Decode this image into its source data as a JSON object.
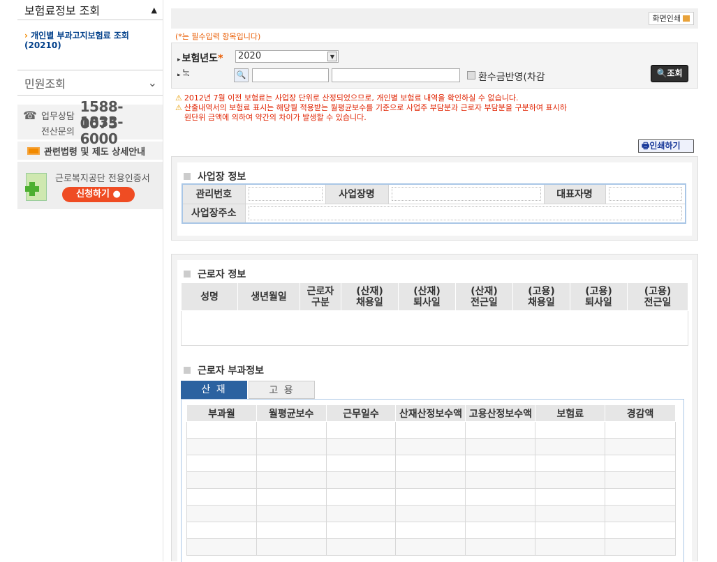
{
  "sidebar": {
    "title": "보험료정보 조회",
    "link": "개인별 부과고지보험료 조회(20210)",
    "link_arrow": "›",
    "civil": "민원조회",
    "contact": {
      "label1": "업무상담",
      "num1": "1588-0075",
      "label2": "전산문의",
      "num2": "1833-6000"
    },
    "law": "관련법령 및 제도 상세안내",
    "cert_title": "근로복지공단 전용인증서",
    "cert_button": "신청하기 ●"
  },
  "main": {
    "screen_print": "화면인쇄",
    "required_note": "(*는 필수입력 항목입니다)",
    "year_label": "보험년도",
    "year_star": "*",
    "year_value": "2020",
    "row2_label": "ᄂᆞᆨ",
    "refund_label": "환수금반영(차감",
    "query_button": "조회",
    "notes": [
      "2012년 7월 이전 보험료는 사업장 단위로 산정되었으므로, 개인별 보험료 내역을 확인하실 수 없습니다.",
      "산출내역서의 보험료 표시는 해당월 적용받는 월평균보수를 기준으로 사업주 부담분과 근로자 부담분을 구분하여 표시하",
      "원단위 금액에 의하여 약간의 차이가 발생할 수 있습니다."
    ],
    "print_button": "인쇄하기",
    "biz_section": "사업장 정보",
    "biz_labels": {
      "mgmt": "관리번호",
      "name": "사업장명",
      "rep": "대표자명",
      "addr": "사업장주소"
    },
    "worker_section": "근로자 정보",
    "worker_headers": [
      "성명",
      "생년월일",
      "근로자\n구분",
      "(산재)\n채용일",
      "(산재)\n퇴사일",
      "(산재)\n전근일",
      "(고용)\n채용일",
      "(고용)\n퇴사일",
      "(고용)\n전근일"
    ],
    "charge_section": "근로자 부과정보",
    "tabs": [
      "산 재",
      "고 용"
    ],
    "charge_headers": [
      "부과월",
      "월평균보수",
      "근무일수",
      "산재산정보수액",
      "고용산정보수액",
      "보험료",
      "경감액"
    ]
  },
  "colors": {
    "accent_blue": "#2b62a0",
    "warning_red": "#e02200",
    "orange": "#f28a00"
  }
}
